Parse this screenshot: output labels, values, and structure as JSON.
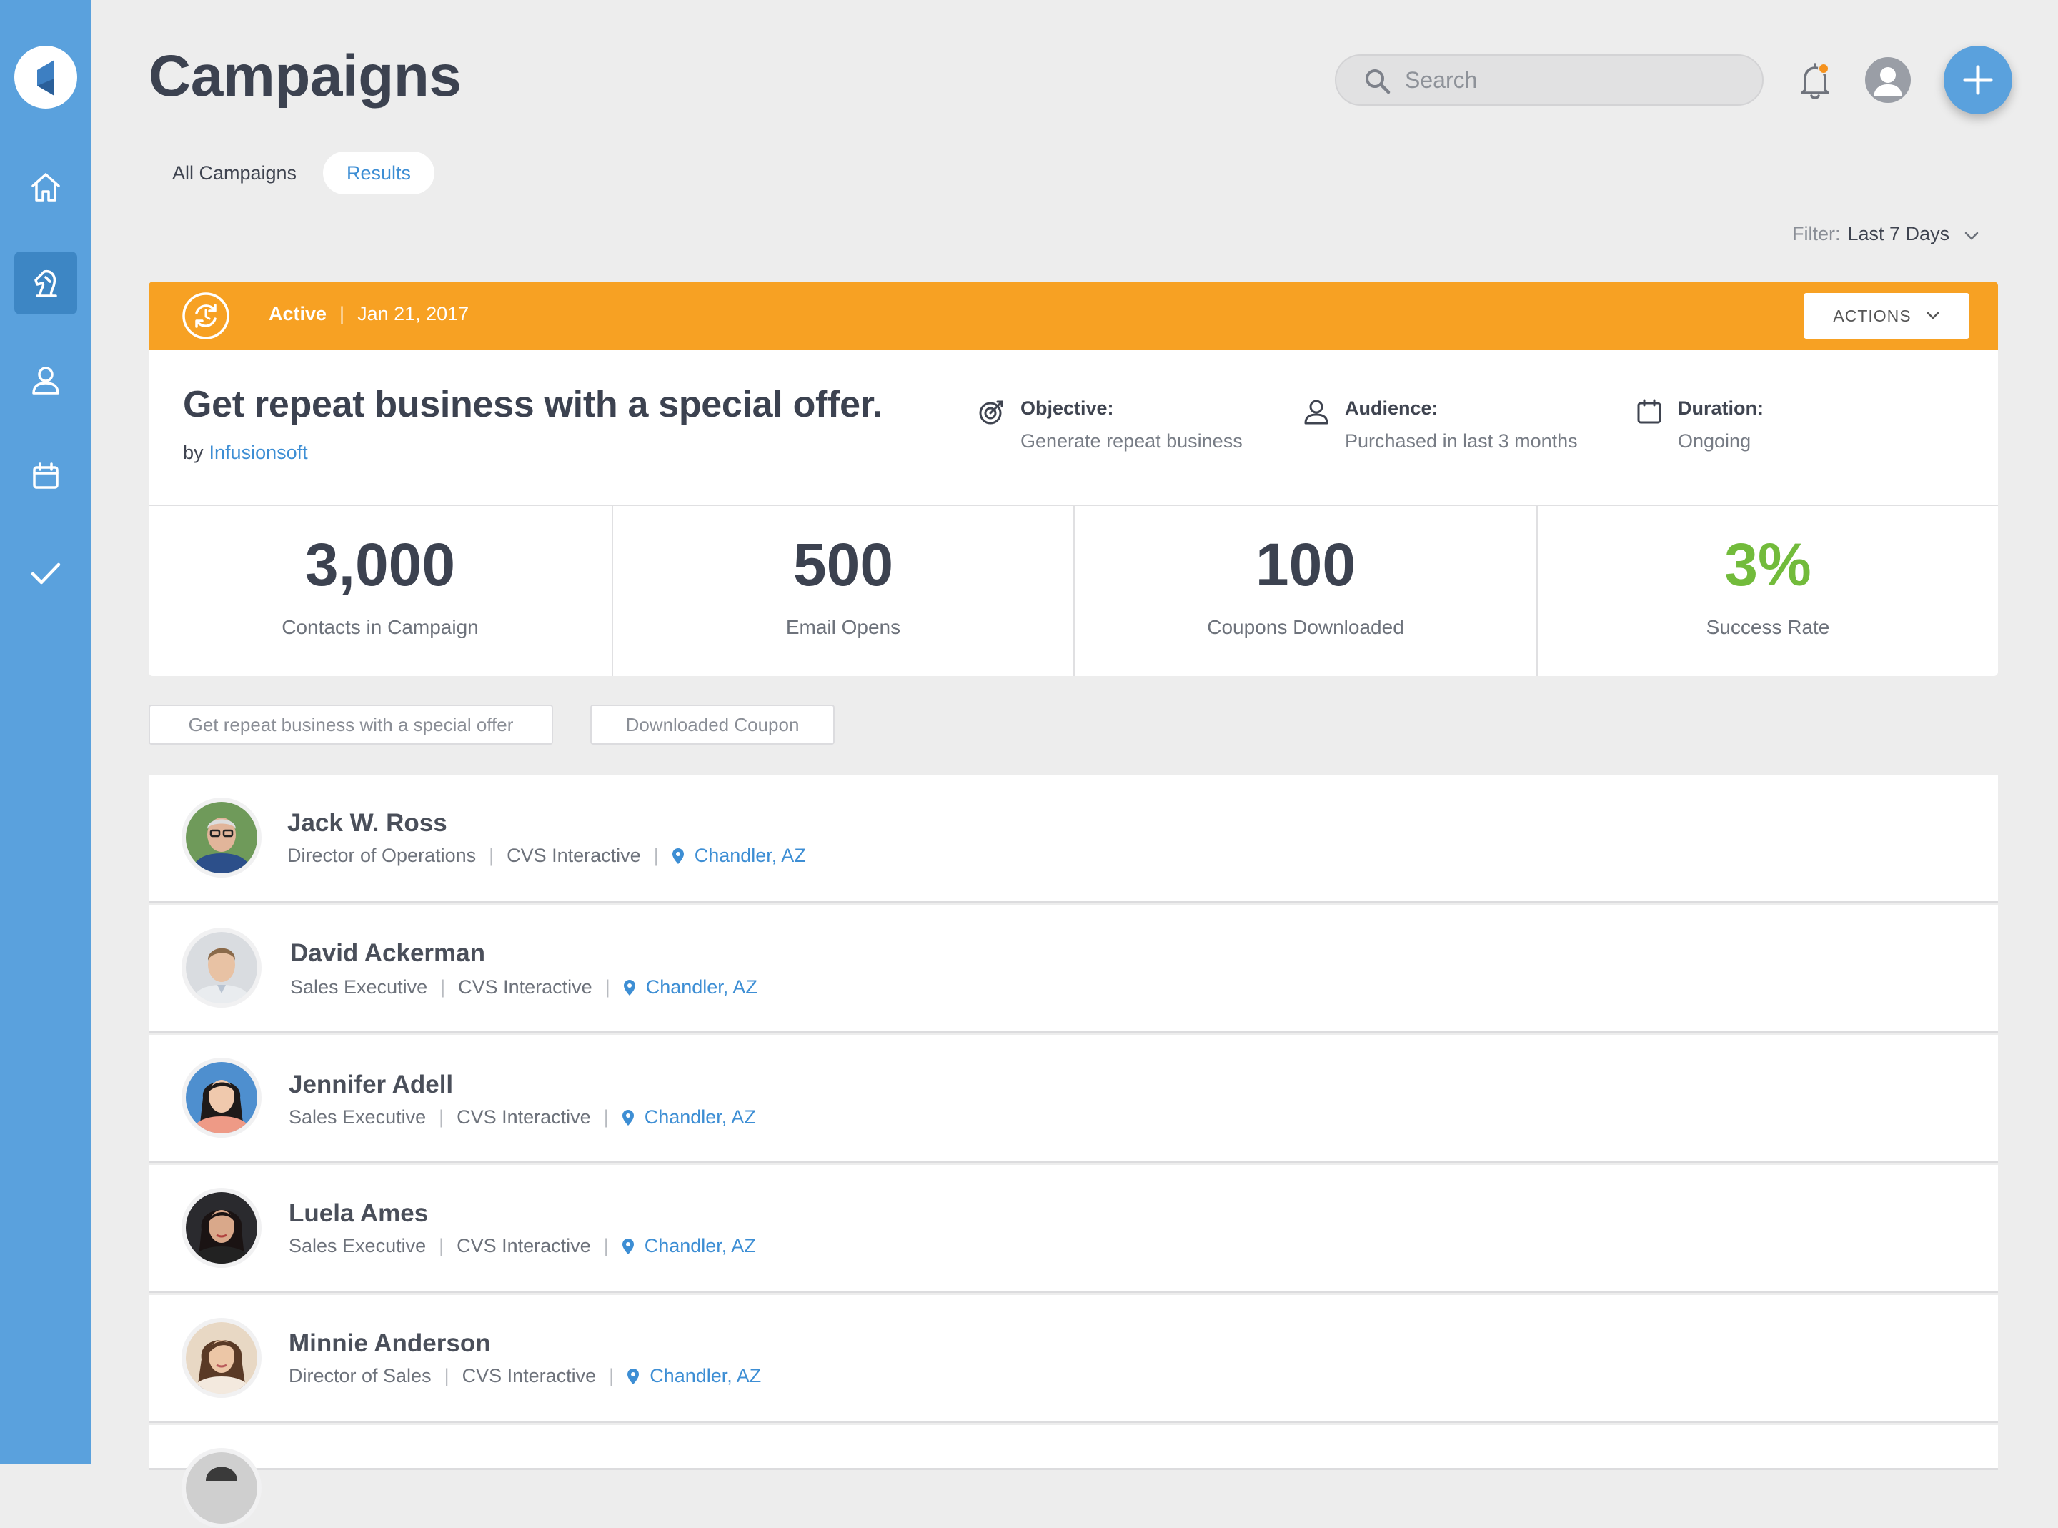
{
  "header": {
    "title": "Campaigns",
    "search_placeholder": "Search"
  },
  "tabs": [
    {
      "label": "All Campaigns",
      "active": false
    },
    {
      "label": "Results",
      "active": true
    }
  ],
  "filter": {
    "label": "Filter:",
    "value": "Last 7 Days"
  },
  "sidebar": {
    "items": [
      {
        "icon": "home-icon"
      },
      {
        "icon": "campaign-icon",
        "active": true
      },
      {
        "icon": "contacts-icon"
      },
      {
        "icon": "calendar-icon"
      },
      {
        "icon": "checkmark-icon"
      }
    ]
  },
  "campaign": {
    "status": "Active",
    "date": "Jan 21, 2017",
    "actions_label": "ACTIONS",
    "title": "Get repeat business with a special offer.",
    "by_prefix": "by",
    "author": "Infusionsoft",
    "objective": {
      "label": "Objective:",
      "value": "Generate repeat business"
    },
    "audience": {
      "label": "Audience:",
      "value": "Purchased in last 3 months"
    },
    "duration": {
      "label": "Duration:",
      "value": "Ongoing"
    }
  },
  "stats": [
    {
      "value": "3,000",
      "label": "Contacts in Campaign"
    },
    {
      "value": "500",
      "label": "Email Opens"
    },
    {
      "value": "100",
      "label": "Coupons Downloaded"
    },
    {
      "value": "3%",
      "label": "Success Rate"
    }
  ],
  "chips": [
    "Get repeat business with a special offer",
    "Downloaded Coupon"
  ],
  "contacts": [
    {
      "name": "Jack  W. Ross",
      "title": "Director of Operations",
      "company": "CVS Interactive",
      "location": "Chandler, AZ"
    },
    {
      "name": "David Ackerman",
      "title": "Sales Executive",
      "company": "CVS Interactive",
      "location": "Chandler, AZ"
    },
    {
      "name": "Jennifer Adell",
      "title": "Sales Executive",
      "company": "CVS Interactive",
      "location": "Chandler, AZ"
    },
    {
      "name": "Luela Ames",
      "title": "Sales Executive",
      "company": "CVS Interactive",
      "location": "Chandler, AZ"
    },
    {
      "name": "Minnie Anderson",
      "title": "Director of Sales",
      "company": "CVS Interactive",
      "location": "Chandler, AZ"
    }
  ],
  "colors": {
    "sidebar": "#5aa1dd",
    "sidebar_active": "#3d86c4",
    "status_bar": "#f7a123",
    "link": "#3d8ed4",
    "success": "#72bb3b",
    "notification": "#f5921e"
  }
}
